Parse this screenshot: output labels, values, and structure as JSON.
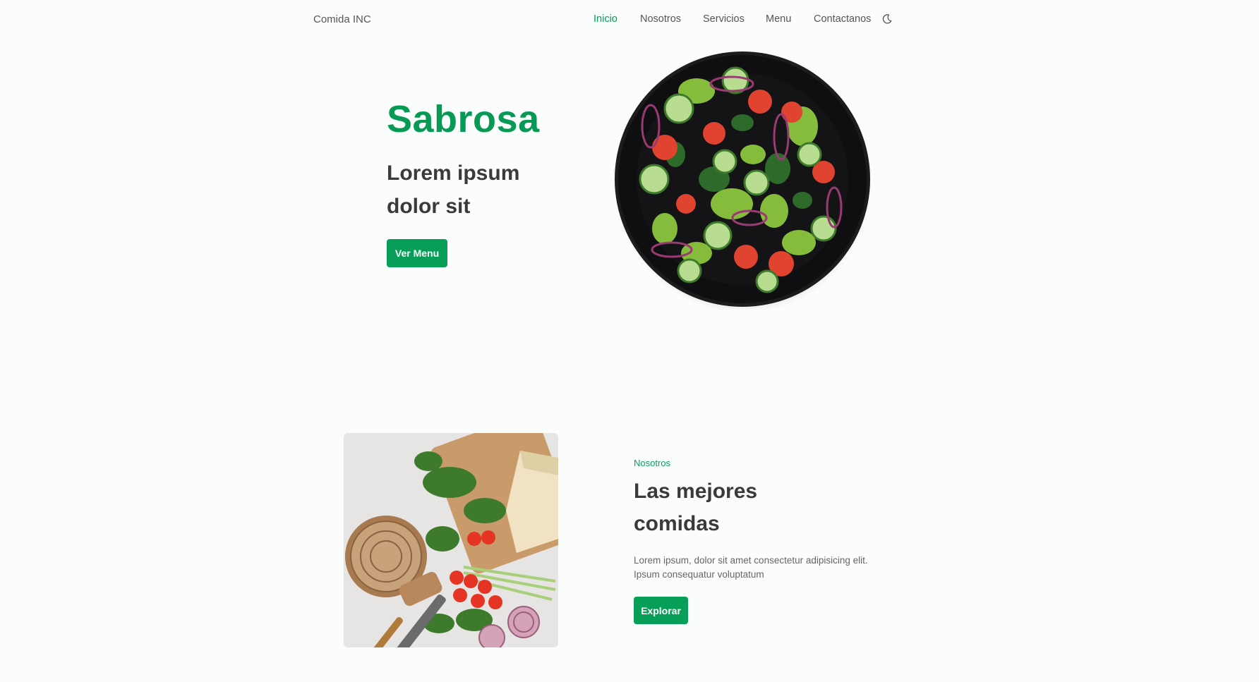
{
  "brand": "Comida INC",
  "nav": {
    "items": [
      {
        "label": "Inicio",
        "active": true
      },
      {
        "label": "Nosotros",
        "active": false
      },
      {
        "label": "Servicios",
        "active": false
      },
      {
        "label": "Menu",
        "active": false
      },
      {
        "label": "Contactanos",
        "active": false
      }
    ],
    "theme_icon": "moon-icon"
  },
  "hero": {
    "title": "Sabrosa",
    "subtitle": "Lorem ipsum dolor sit",
    "button_label": "Ver Menu",
    "image_icon": "salad-bowl-image"
  },
  "about": {
    "kicker": "Nosotros",
    "title": "Las mejores comidas",
    "description": "Lorem ipsum, dolor sit amet consectetur adipisicing elit. Ipsum consequatur voluptatum",
    "button_label": "Explorar",
    "image_icon": "ingredients-image"
  },
  "colors": {
    "accent": "#079f58",
    "text": "#3a3a3a",
    "muted": "#555555",
    "background": "#fbfcfc"
  }
}
